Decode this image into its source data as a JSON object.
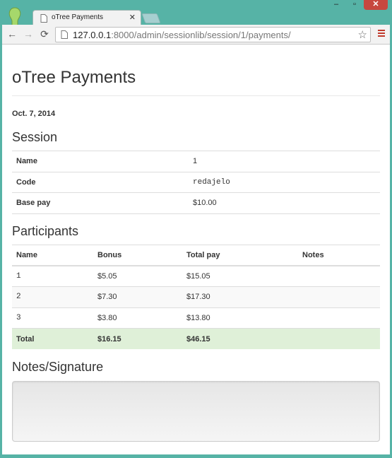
{
  "browser": {
    "tab": {
      "title": "oTree Payments"
    },
    "url": {
      "host": "127.0.0.1",
      "rest": ":8000/admin/sessionlib/session/1/payments/"
    },
    "icons": {
      "profile": "profile-icon",
      "favicon": "page-icon",
      "close": "close-icon",
      "back": "back-arrow-icon",
      "forward": "forward-arrow-icon",
      "reload": "reload-icon",
      "star": "star-icon",
      "menu": "hamburger-menu-icon"
    }
  },
  "page": {
    "title": "oTree Payments",
    "date": "Oct. 7, 2014"
  },
  "session": {
    "heading": "Session",
    "rows": [
      {
        "label": "Name",
        "value": "1"
      },
      {
        "label": "Code",
        "value": "redajelo"
      },
      {
        "label": "Base pay",
        "value": "$10.00"
      }
    ]
  },
  "participants": {
    "heading": "Participants",
    "columns": [
      "Name",
      "Bonus",
      "Total pay",
      "Notes"
    ],
    "rows": [
      {
        "name": "1",
        "bonus": "$5.05",
        "total_pay": "$15.05",
        "notes": ""
      },
      {
        "name": "2",
        "bonus": "$7.30",
        "total_pay": "$17.30",
        "notes": ""
      },
      {
        "name": "3",
        "bonus": "$3.80",
        "total_pay": "$13.80",
        "notes": ""
      }
    ],
    "total": {
      "label": "Total",
      "bonus": "$16.15",
      "total_pay": "$46.15"
    }
  },
  "notes": {
    "heading": "Notes/Signature",
    "value": ""
  },
  "colors": {
    "window_frame": "#56b3a6",
    "total_row": "#dff0d8"
  }
}
